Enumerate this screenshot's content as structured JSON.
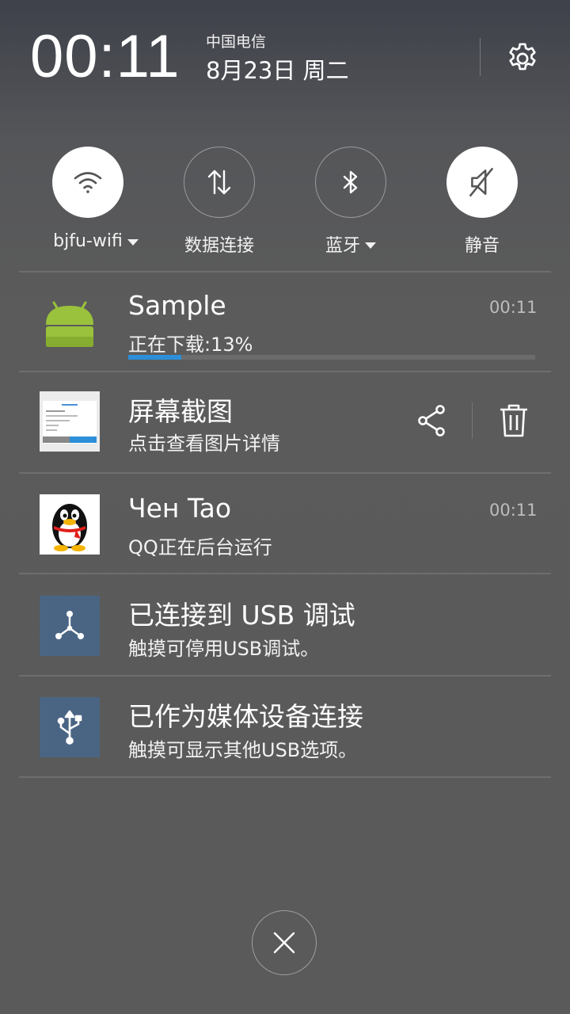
{
  "header": {
    "time": "00:11",
    "carrier": "中国电信",
    "date": "8月23日 周二"
  },
  "toggles": [
    {
      "label": "bjfu-wifi",
      "icon": "wifi-icon",
      "state": "on",
      "has_dropdown": true
    },
    {
      "label": "数据连接",
      "icon": "data-arrows-icon",
      "state": "off",
      "has_dropdown": false
    },
    {
      "label": "蓝牙",
      "icon": "bluetooth-icon",
      "state": "off",
      "has_dropdown": true
    },
    {
      "label": "静音",
      "icon": "mute-icon",
      "state": "on",
      "has_dropdown": false
    }
  ],
  "notifications": [
    {
      "app_icon": "android-icon",
      "title": "Sample",
      "subtitle": "正在下载:13%",
      "time": "00:11",
      "progress": 0.13
    },
    {
      "app_icon": "screenshot-thumbnail",
      "title": "屏幕截图",
      "subtitle": "点击查看图片详情",
      "actions": [
        "share-icon",
        "delete-icon"
      ]
    },
    {
      "app_icon": "qq-penguin-icon",
      "title": "Чен Tao",
      "subtitle": "QQ正在后台运行",
      "time": "00:11"
    },
    {
      "app_icon": "usb-debug-icon",
      "title": "已连接到 USB 调试",
      "subtitle": "触摸可停用USB调试。"
    },
    {
      "app_icon": "usb-icon",
      "title": "已作为媒体设备连接",
      "subtitle": "触摸可显示其他USB选项。"
    }
  ],
  "colors": {
    "accent": "#2d8fd8",
    "icon_tile": "#4a6584",
    "android_green": "#9ac23c"
  }
}
